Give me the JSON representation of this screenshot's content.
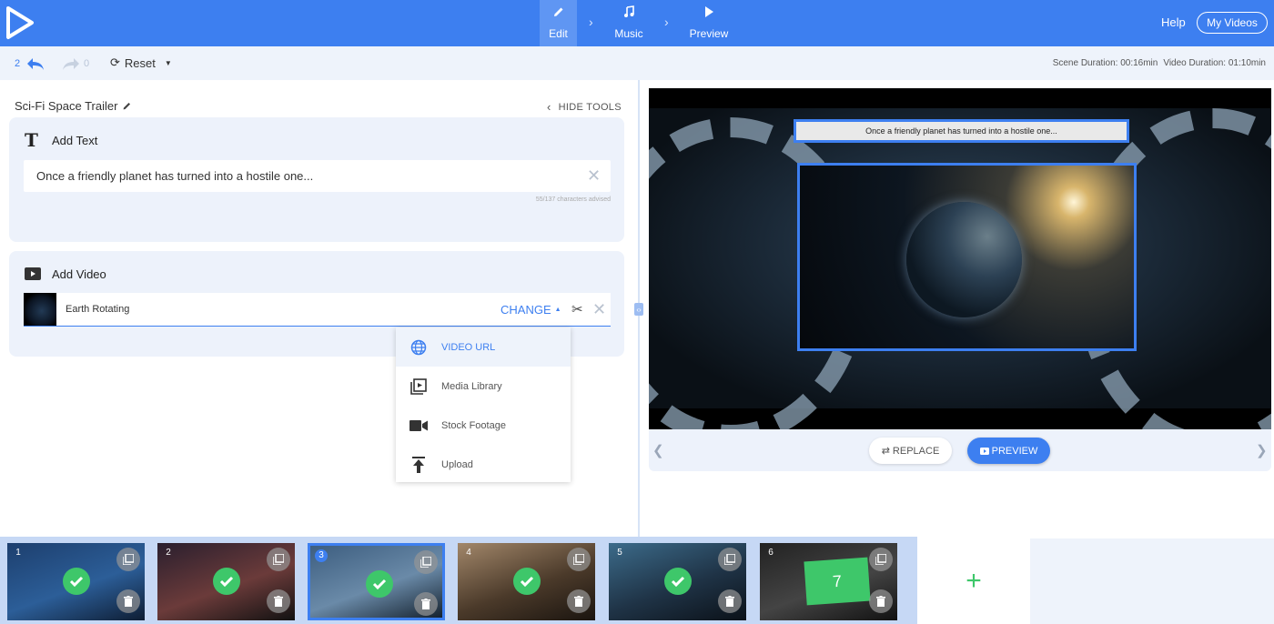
{
  "header": {
    "steps": [
      {
        "label": "Edit",
        "icon": "pencil-icon"
      },
      {
        "label": "Music",
        "icon": "music-note-icon"
      },
      {
        "label": "Preview",
        "icon": "play-icon"
      }
    ],
    "help_label": "Help",
    "my_videos_label": "My Videos"
  },
  "toolbar": {
    "undo_count": "2",
    "redo_count": "0",
    "reset_label": "Reset",
    "scene_duration": "Scene Duration: 00:16min",
    "video_duration": "Video Duration: 01:10min"
  },
  "editor": {
    "project_title": "Sci-Fi Space Trailer",
    "hide_tools_label": "HIDE TOOLS",
    "text_card": {
      "title": "Add Text",
      "value": "Once a friendly planet has turned into a hostile one...",
      "chars_hint": "55/137 characters advised"
    },
    "video_card": {
      "title": "Add Video",
      "video_name": "Earth Rotating",
      "change_label": "CHANGE"
    },
    "dropdown": [
      {
        "label": "VIDEO URL",
        "icon": "globe-icon"
      },
      {
        "label": "Media Library",
        "icon": "media-library-icon"
      },
      {
        "label": "Stock Footage",
        "icon": "video-camera-icon"
      },
      {
        "label": "Upload",
        "icon": "upload-icon"
      }
    ]
  },
  "preview": {
    "caption": "Once a friendly planet has turned into a hostile one...",
    "replace_label": "REPLACE",
    "preview_label": "PREVIEW"
  },
  "scenes": [
    {
      "number": "1",
      "done": true,
      "colors": [
        "#1d3f6e",
        "#2c5e98",
        "#0e1d33"
      ]
    },
    {
      "number": "2",
      "done": true,
      "colors": [
        "#2a1f2e",
        "#6b3b3a",
        "#111"
      ]
    },
    {
      "number": "3",
      "done": true,
      "colors": [
        "#3d5e80",
        "#6a8aa8",
        "#15222f"
      ]
    },
    {
      "number": "4",
      "done": true,
      "colors": [
        "#a2876a",
        "#4b3a2a",
        "#1a140f"
      ]
    },
    {
      "number": "5",
      "done": true,
      "colors": [
        "#3c6b8a",
        "#1f3346",
        "#0b1118"
      ]
    },
    {
      "number": "6",
      "done": false,
      "colors": [
        "#222",
        "#444",
        "#111"
      ],
      "placeholder": "7"
    }
  ],
  "colors": {
    "accent": "#3d7ff0",
    "success": "#3ec76a",
    "panel": "#edf2fb"
  }
}
